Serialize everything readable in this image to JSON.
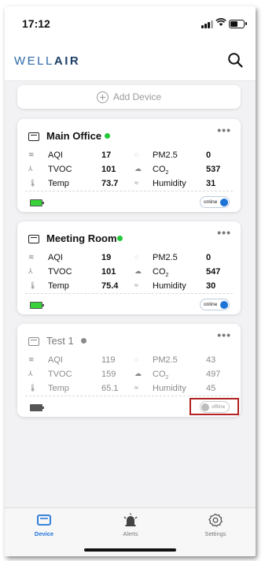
{
  "status_bar": {
    "time": "17:12"
  },
  "header": {
    "logo_light": "WELL",
    "logo_bold": "AIR"
  },
  "add_device": {
    "label": "Add Device"
  },
  "metric_labels": {
    "aqi": "AQI",
    "tvoc": "TVOC",
    "temp": "Temp",
    "pm25": "PM2.5",
    "co2": "CO",
    "co2_sub": "2",
    "humidity": "Humidity"
  },
  "devices": [
    {
      "name": "Main Office",
      "status_color": "#22c83a",
      "aqi": "17",
      "tvoc": "101",
      "temp": "73.7",
      "pm25": "0",
      "co2": "537",
      "humidity": "31",
      "toggle": "online"
    },
    {
      "name": "Meeting Room",
      "status_color": "#22c83a",
      "aqi": "19",
      "tvoc": "101",
      "temp": "75.4",
      "pm25": "0",
      "co2": "547",
      "humidity": "30",
      "toggle": "online"
    },
    {
      "name": "Test 1",
      "status_color": "#8a8a8a",
      "aqi": "119",
      "tvoc": "159",
      "temp": "65.1",
      "pm25": "43",
      "co2": "497",
      "humidity": "45",
      "toggle": "offline"
    }
  ],
  "more_label": "•••",
  "tabs": [
    {
      "label": "Device",
      "icon": "device-icon",
      "active": true
    },
    {
      "label": "Alerts",
      "icon": "alarm-icon",
      "active": false
    },
    {
      "label": "Settings",
      "icon": "gear-icon",
      "active": false
    }
  ],
  "colors": {
    "accent": "#1e73d6",
    "online": "#22c83a",
    "highlight": "#b22222"
  }
}
